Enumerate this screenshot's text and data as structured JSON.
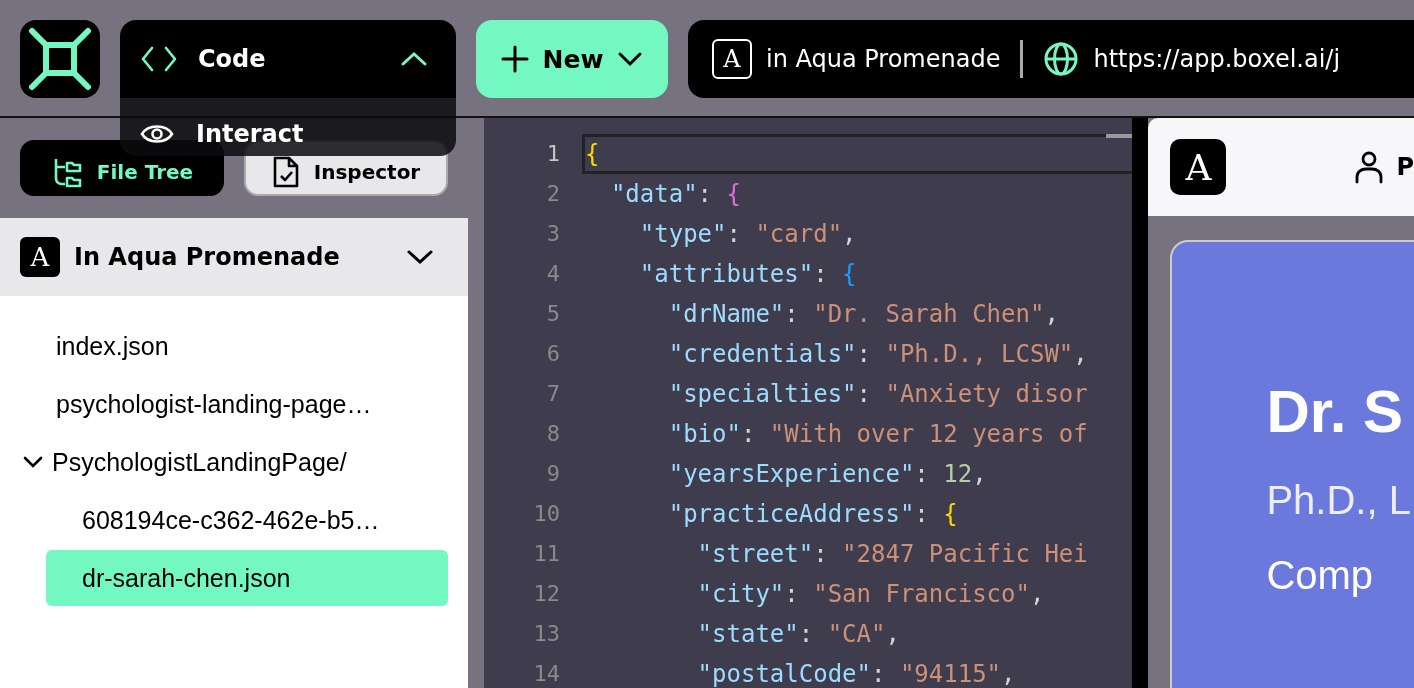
{
  "top_bar": {
    "mode_menu": {
      "current": "Code",
      "expanded": true,
      "options": [
        {
          "label": "Interact"
        }
      ]
    },
    "new_button": {
      "label": "New"
    },
    "address_bar": {
      "realm_letter": "A",
      "realm": "in Aqua Promenade",
      "url": "https://app.boxel.ai/j"
    }
  },
  "left_panel": {
    "tabs": [
      {
        "label": "File Tree",
        "selected": true
      },
      {
        "label": "Inspector",
        "selected": false
      }
    ],
    "realm": {
      "letter": "A",
      "name": "In Aqua Promenade"
    },
    "files": [
      {
        "kind": "file",
        "name": "index.json",
        "selected": false
      },
      {
        "kind": "file",
        "name": "psychologist-landing-page…",
        "selected": false
      },
      {
        "kind": "folder",
        "name": "PsychologistLandingPage/",
        "selected": false,
        "expanded": true,
        "children": [
          {
            "kind": "file",
            "name": "608194ce-c362-462e-b5…",
            "selected": false
          },
          {
            "kind": "file",
            "name": "dr-sarah-chen.json",
            "selected": true
          }
        ]
      }
    ]
  },
  "editor": {
    "lines": [
      {
        "number": "1",
        "active": true,
        "tokens": [
          {
            "kind": "brace",
            "color": "#ffd700",
            "text": "{"
          }
        ]
      },
      {
        "number": "2",
        "active": false,
        "tokens": [
          {
            "kind": "key",
            "text": "  \"data\""
          },
          {
            "kind": "punct",
            "text": ": "
          },
          {
            "kind": "brace",
            "color": "#da70d6",
            "text": "{"
          }
        ]
      },
      {
        "number": "3",
        "active": false,
        "tokens": [
          {
            "kind": "key",
            "text": "    \"type\""
          },
          {
            "kind": "punct",
            "text": ": "
          },
          {
            "kind": "string",
            "text": "\"card\""
          },
          {
            "kind": "punct",
            "text": ","
          }
        ]
      },
      {
        "number": "4",
        "active": false,
        "tokens": [
          {
            "kind": "key",
            "text": "    \"attributes\""
          },
          {
            "kind": "punct",
            "text": ": "
          },
          {
            "kind": "brace",
            "color": "#179fff",
            "text": "{"
          }
        ]
      },
      {
        "number": "5",
        "active": false,
        "tokens": [
          {
            "kind": "key",
            "text": "      \"drName\""
          },
          {
            "kind": "punct",
            "text": ": "
          },
          {
            "kind": "string",
            "text": "\"Dr. Sarah Chen\""
          },
          {
            "kind": "punct",
            "text": ","
          }
        ]
      },
      {
        "number": "6",
        "active": false,
        "tokens": [
          {
            "kind": "key",
            "text": "      \"credentials\""
          },
          {
            "kind": "punct",
            "text": ": "
          },
          {
            "kind": "string",
            "text": "\"Ph.D., LCSW\""
          },
          {
            "kind": "punct",
            "text": ","
          }
        ]
      },
      {
        "number": "7",
        "active": false,
        "tokens": [
          {
            "kind": "key",
            "text": "      \"specialties\""
          },
          {
            "kind": "punct",
            "text": ": "
          },
          {
            "kind": "string",
            "text": "\"Anxiety disor"
          }
        ]
      },
      {
        "number": "8",
        "active": false,
        "tokens": [
          {
            "kind": "key",
            "text": "      \"bio\""
          },
          {
            "kind": "punct",
            "text": ": "
          },
          {
            "kind": "string",
            "text": "\"With over 12 years of"
          }
        ]
      },
      {
        "number": "9",
        "active": false,
        "tokens": [
          {
            "kind": "key",
            "text": "      \"yearsExperience\""
          },
          {
            "kind": "punct",
            "text": ": "
          },
          {
            "kind": "number",
            "text": "12"
          },
          {
            "kind": "punct",
            "text": ","
          }
        ]
      },
      {
        "number": "10",
        "active": false,
        "tokens": [
          {
            "kind": "key",
            "text": "      \"practiceAddress\""
          },
          {
            "kind": "punct",
            "text": ": "
          },
          {
            "kind": "brace",
            "color": "#ffd700",
            "text": "{"
          }
        ]
      },
      {
        "number": "11",
        "active": false,
        "tokens": [
          {
            "kind": "key",
            "text": "        \"street\""
          },
          {
            "kind": "punct",
            "text": ": "
          },
          {
            "kind": "string",
            "text": "\"2847 Pacific Hei"
          }
        ]
      },
      {
        "number": "12",
        "active": false,
        "tokens": [
          {
            "kind": "key",
            "text": "        \"city\""
          },
          {
            "kind": "punct",
            "text": ": "
          },
          {
            "kind": "string",
            "text": "\"San Francisco\""
          },
          {
            "kind": "punct",
            "text": ","
          }
        ]
      },
      {
        "number": "13",
        "active": false,
        "tokens": [
          {
            "kind": "key",
            "text": "        \"state\""
          },
          {
            "kind": "punct",
            "text": ": "
          },
          {
            "kind": "string",
            "text": "\"CA\""
          },
          {
            "kind": "punct",
            "text": ","
          }
        ]
      },
      {
        "number": "14",
        "active": false,
        "tokens": [
          {
            "kind": "key",
            "text": "        \"postalCode\""
          },
          {
            "kind": "punct",
            "text": ": "
          },
          {
            "kind": "string",
            "text": "\"94115\""
          },
          {
            "kind": "punct",
            "text": ","
          }
        ]
      }
    ]
  },
  "preview": {
    "header": {
      "letter": "A",
      "label": "P"
    },
    "card": {
      "name": "Dr. S",
      "credentials": "Ph.D., L",
      "tagline": "Comp"
    }
  }
}
